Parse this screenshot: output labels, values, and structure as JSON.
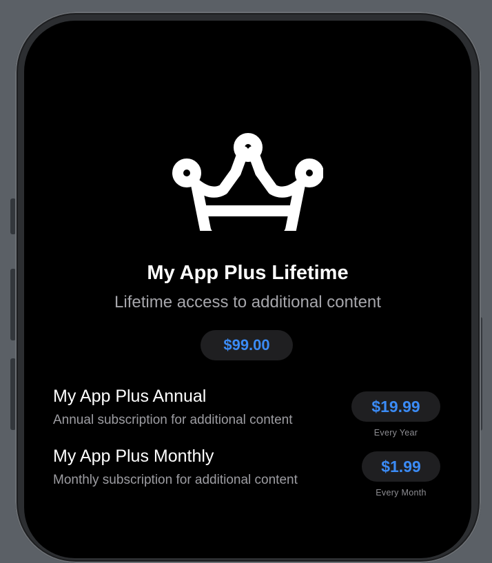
{
  "hero": {
    "icon": "crown-icon",
    "title": "My App Plus Lifetime",
    "subtitle": "Lifetime access to additional content",
    "price": "$99.00"
  },
  "products": [
    {
      "title": "My App Plus Annual",
      "description": "Annual subscription for additional content",
      "price": "$19.99",
      "period": "Every Year"
    },
    {
      "title": "My App Plus Monthly",
      "description": "Monthly subscription for additional content",
      "price": "$1.99",
      "period": "Every Month"
    }
  ],
  "colors": {
    "background": "#000000",
    "accent": "#3b8bf5",
    "pill": "#1f1f21",
    "secondary_text": "#9d9da2",
    "device_backdrop": "#5b6066"
  }
}
